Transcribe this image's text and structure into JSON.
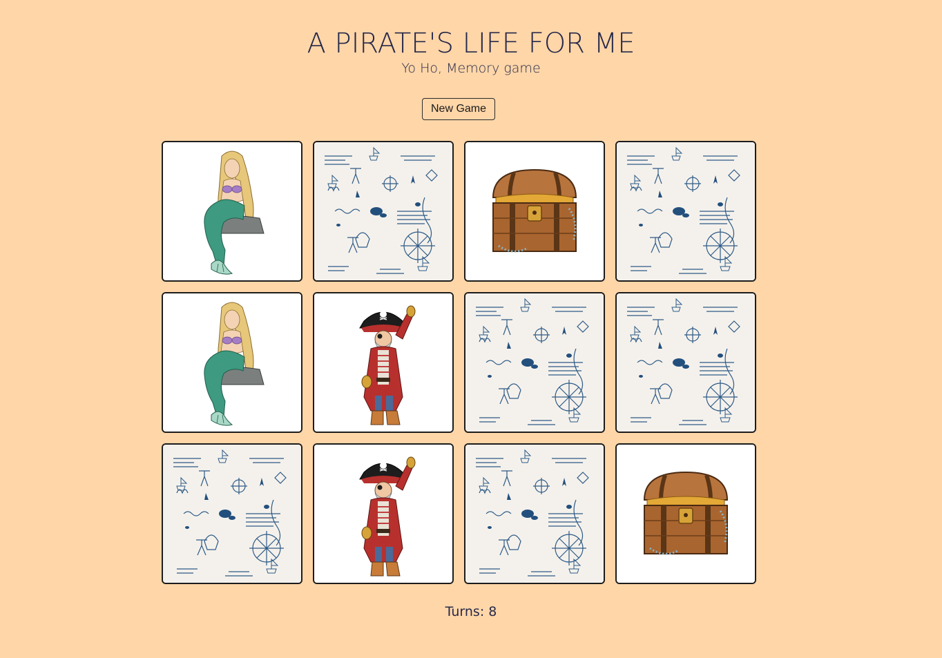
{
  "header": {
    "title": "A PIRATE'S LIFE FOR ME",
    "subtitle": "Yo Ho, Memory game"
  },
  "controls": {
    "new_game_label": "New Game"
  },
  "board": {
    "columns": 4,
    "rows": 3,
    "cards": [
      {
        "face": "mermaid",
        "state": "face-up"
      },
      {
        "face": "card-back",
        "state": "face-down"
      },
      {
        "face": "treasure-chest",
        "state": "face-up"
      },
      {
        "face": "card-back",
        "state": "face-down"
      },
      {
        "face": "mermaid",
        "state": "face-up"
      },
      {
        "face": "pirate-captain",
        "state": "face-up"
      },
      {
        "face": "card-back",
        "state": "face-down"
      },
      {
        "face": "card-back",
        "state": "face-down"
      },
      {
        "face": "card-back",
        "state": "face-down"
      },
      {
        "face": "pirate-captain",
        "state": "face-up"
      },
      {
        "face": "card-back",
        "state": "face-down"
      },
      {
        "face": "treasure-chest",
        "state": "face-up"
      }
    ]
  },
  "status": {
    "turns_text": "Turns: 8"
  },
  "colors": {
    "background": "#fed6a8",
    "text": "#27284a",
    "card_border": "#1c1c1c",
    "map_ink": "#2d5a86"
  }
}
